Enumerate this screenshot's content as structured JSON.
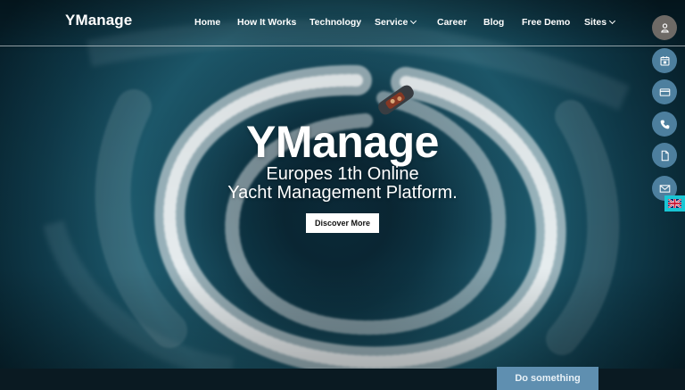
{
  "header": {
    "logo": "YManage",
    "nav": [
      {
        "label": "Home",
        "dropdown": false
      },
      {
        "label": "How It Works",
        "dropdown": false
      },
      {
        "label": "Technology",
        "dropdown": false
      },
      {
        "label": "Service",
        "dropdown": true
      },
      {
        "label": "Career",
        "dropdown": false
      },
      {
        "label": "Blog",
        "dropdown": false
      },
      {
        "label": "Free Demo",
        "dropdown": false
      },
      {
        "label": "Sites",
        "dropdown": true
      }
    ]
  },
  "hero": {
    "title": "YManage",
    "subtitle_line1": "Europes 1th Online",
    "subtitle_line2": "Yacht Management Platform.",
    "cta_label": "Discover More"
  },
  "side_buttons": [
    {
      "icon": "user-icon"
    },
    {
      "icon": "calendar-icon"
    },
    {
      "icon": "credit-card-icon"
    },
    {
      "icon": "phone-icon"
    },
    {
      "icon": "document-icon"
    },
    {
      "icon": "mail-icon"
    }
  ],
  "language": {
    "icon": "uk-flag-icon"
  },
  "floating_button": {
    "label": "Do something"
  },
  "colors": {
    "side_button": "#4d7f9e",
    "user_button": "#6e6a66",
    "flag_tab": "#18c6d4",
    "floating_button": "#5f8fb0"
  }
}
